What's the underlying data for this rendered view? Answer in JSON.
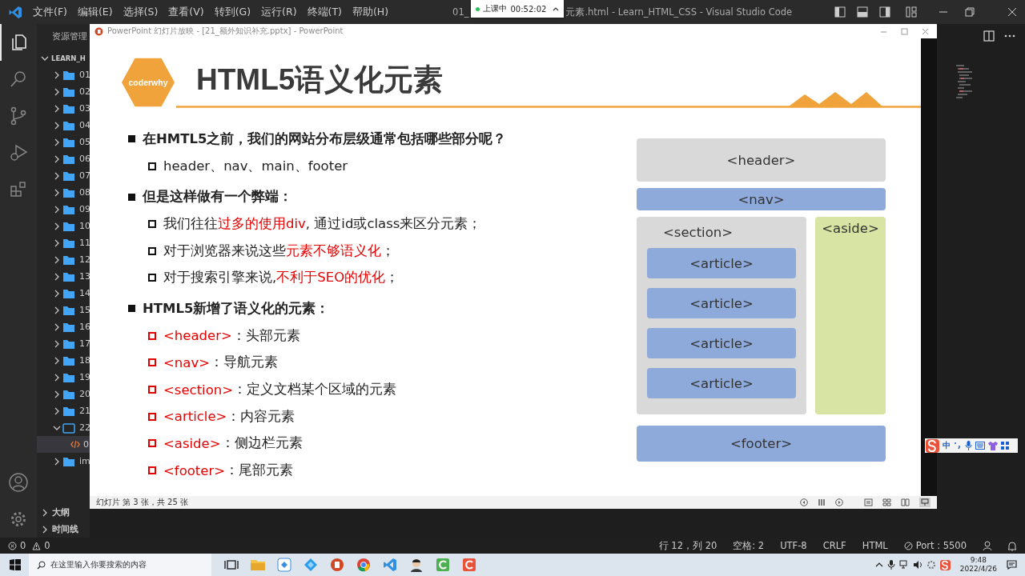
{
  "vscode": {
    "title_bar": {
      "menu": [
        "文件(F)",
        "编辑(E)",
        "选择(S)",
        "查看(V)",
        "转到(G)",
        "运行(R)",
        "终端(T)",
        "帮助(H)"
      ],
      "title_left": "01_",
      "title_right": "元素.html - Learn_HTML_CSS - Visual Studio Code"
    },
    "recorder": {
      "label": "上课中",
      "time": "00:52:02"
    },
    "activity_bar": [
      {
        "kind": "explorer",
        "selected": true
      },
      {
        "kind": "search",
        "selected": false
      },
      {
        "kind": "source-control",
        "selected": false
      },
      {
        "kind": "run",
        "selected": false
      },
      {
        "kind": "extensions",
        "selected": false
      }
    ],
    "activity_bottom": [
      {
        "kind": "account"
      },
      {
        "kind": "settings"
      }
    ],
    "sidebar": {
      "title": "资源管理",
      "root": {
        "label": "LEARN_H",
        "expanded": true,
        "children": [
          {
            "label": "01",
            "kind": "folder",
            "expanded": false,
            "selected": false
          },
          {
            "label": "02",
            "kind": "folder",
            "expanded": false,
            "selected": false
          },
          {
            "label": "03",
            "kind": "folder",
            "expanded": false,
            "selected": false
          },
          {
            "label": "04",
            "kind": "folder",
            "expanded": false,
            "selected": false
          },
          {
            "label": "05",
            "kind": "folder",
            "expanded": false,
            "selected": false
          },
          {
            "label": "06",
            "kind": "folder",
            "expanded": false,
            "selected": false
          },
          {
            "label": "07",
            "kind": "folder",
            "expanded": false,
            "selected": false
          },
          {
            "label": "08",
            "kind": "folder",
            "expanded": false,
            "selected": false
          },
          {
            "label": "09",
            "kind": "folder",
            "expanded": false,
            "selected": false
          },
          {
            "label": "10",
            "kind": "folder",
            "expanded": false,
            "selected": false
          },
          {
            "label": "11",
            "kind": "folder",
            "expanded": false,
            "selected": false
          },
          {
            "label": "12",
            "kind": "folder",
            "expanded": false,
            "selected": false
          },
          {
            "label": "13",
            "kind": "folder",
            "expanded": false,
            "selected": false
          },
          {
            "label": "14",
            "kind": "folder",
            "expanded": false,
            "selected": false
          },
          {
            "label": "15",
            "kind": "folder",
            "expanded": false,
            "selected": false
          },
          {
            "label": "16",
            "kind": "folder",
            "expanded": false,
            "selected": false
          },
          {
            "label": "17",
            "kind": "folder",
            "expanded": false,
            "selected": false
          },
          {
            "label": "18",
            "kind": "folder",
            "expanded": false,
            "selected": false
          },
          {
            "label": "19",
            "kind": "folder",
            "expanded": false,
            "selected": false
          },
          {
            "label": "20",
            "kind": "folder",
            "expanded": false,
            "selected": false
          },
          {
            "label": "21",
            "kind": "folder",
            "expanded": false,
            "selected": false
          },
          {
            "label": "22",
            "kind": "folder",
            "expanded": true,
            "selected": false,
            "children": [
              {
                "label": "0",
                "kind": "html",
                "selected": true
              }
            ]
          },
          {
            "label": "im",
            "kind": "folder",
            "expanded": false,
            "selected": false
          }
        ]
      },
      "sections": [
        {
          "label": "大纲",
          "expanded": false
        },
        {
          "label": "时间线",
          "expanded": false
        }
      ]
    },
    "status_bar": {
      "errors": "0",
      "warnings": "0",
      "items": [
        "行 12，列 20",
        "空格: 2",
        "UTF-8",
        "CRLF",
        "HTML"
      ],
      "port": "Port : 5500"
    }
  },
  "ime_toolbar": {
    "mode": "中"
  },
  "powerpoint": {
    "title": "PowerPoint 幻灯片放映 - [21_额外知识补充.pptx] - PowerPoint",
    "slide": {
      "logo": "coderwhy",
      "title": "HTML5语义化元素",
      "bullets": [
        {
          "segments": [
            {
              "text": "在HMTL5之前，我们的网站分布层级通常包括哪些部分呢？",
              "highlight": false
            }
          ],
          "children": [
            {
              "kind": "plain",
              "segments": [
                {
                  "text": "header、nav、main、footer",
                  "highlight": false
                }
              ]
            }
          ]
        },
        {
          "segments": [
            {
              "text": "但是这样做有一个弊端：",
              "highlight": false
            }
          ],
          "children": [
            {
              "kind": "plain",
              "segments": [
                {
                  "text": "我们往往",
                  "highlight": false
                },
                {
                  "text": "过多的使用div",
                  "highlight": true
                },
                {
                  "text": ", 通过id或class来区分元素；",
                  "highlight": false
                }
              ]
            },
            {
              "kind": "plain",
              "segments": [
                {
                  "text": "对于浏览器来说这些",
                  "highlight": false
                },
                {
                  "text": "元素不够语义化",
                  "highlight": true
                },
                {
                  "text": "；",
                  "highlight": false
                }
              ]
            },
            {
              "kind": "plain",
              "segments": [
                {
                  "text": "对于搜索引擎来说, ",
                  "highlight": false
                },
                {
                  "text": "不利于SEO的优化",
                  "highlight": true
                },
                {
                  "text": "；",
                  "highlight": false
                }
              ]
            }
          ]
        },
        {
          "segments": [
            {
              "text": "HTML5新增了语义化的元素：",
              "highlight": false
            }
          ],
          "children": [
            {
              "kind": "accent",
              "segments": [
                {
                  "text": "<header>",
                  "highlight": true
                },
                {
                  "text": "：头部元素",
                  "highlight": false
                }
              ]
            },
            {
              "kind": "accent",
              "segments": [
                {
                  "text": "<nav>",
                  "highlight": true
                },
                {
                  "text": "：导航元素",
                  "highlight": false
                }
              ]
            },
            {
              "kind": "accent",
              "segments": [
                {
                  "text": "<section>",
                  "highlight": true
                },
                {
                  "text": "：定义文档某个区域的元素",
                  "highlight": false
                }
              ]
            },
            {
              "kind": "accent",
              "segments": [
                {
                  "text": "<article>",
                  "highlight": true
                },
                {
                  "text": "：内容元素",
                  "highlight": false
                }
              ]
            },
            {
              "kind": "accent",
              "segments": [
                {
                  "text": "<aside>",
                  "highlight": true
                },
                {
                  "text": "：侧边栏元素",
                  "highlight": false
                }
              ]
            },
            {
              "kind": "accent",
              "segments": [
                {
                  "text": "<footer>",
                  "highlight": true
                },
                {
                  "text": "：尾部元素",
                  "highlight": false
                }
              ]
            }
          ]
        }
      ],
      "diagram": {
        "header": "<header>",
        "nav": "<nav>",
        "section": "<section>",
        "articles": [
          "<article>",
          "<article>",
          "<article>",
          "<article>"
        ],
        "aside": "<aside>",
        "footer": "<footer>"
      }
    },
    "status": "幻灯片 第 3 张，共 25 张"
  },
  "taskbar": {
    "search_placeholder": "在这里输入你要搜索的内容",
    "time": "9:48",
    "date": "2022/4/26"
  }
}
